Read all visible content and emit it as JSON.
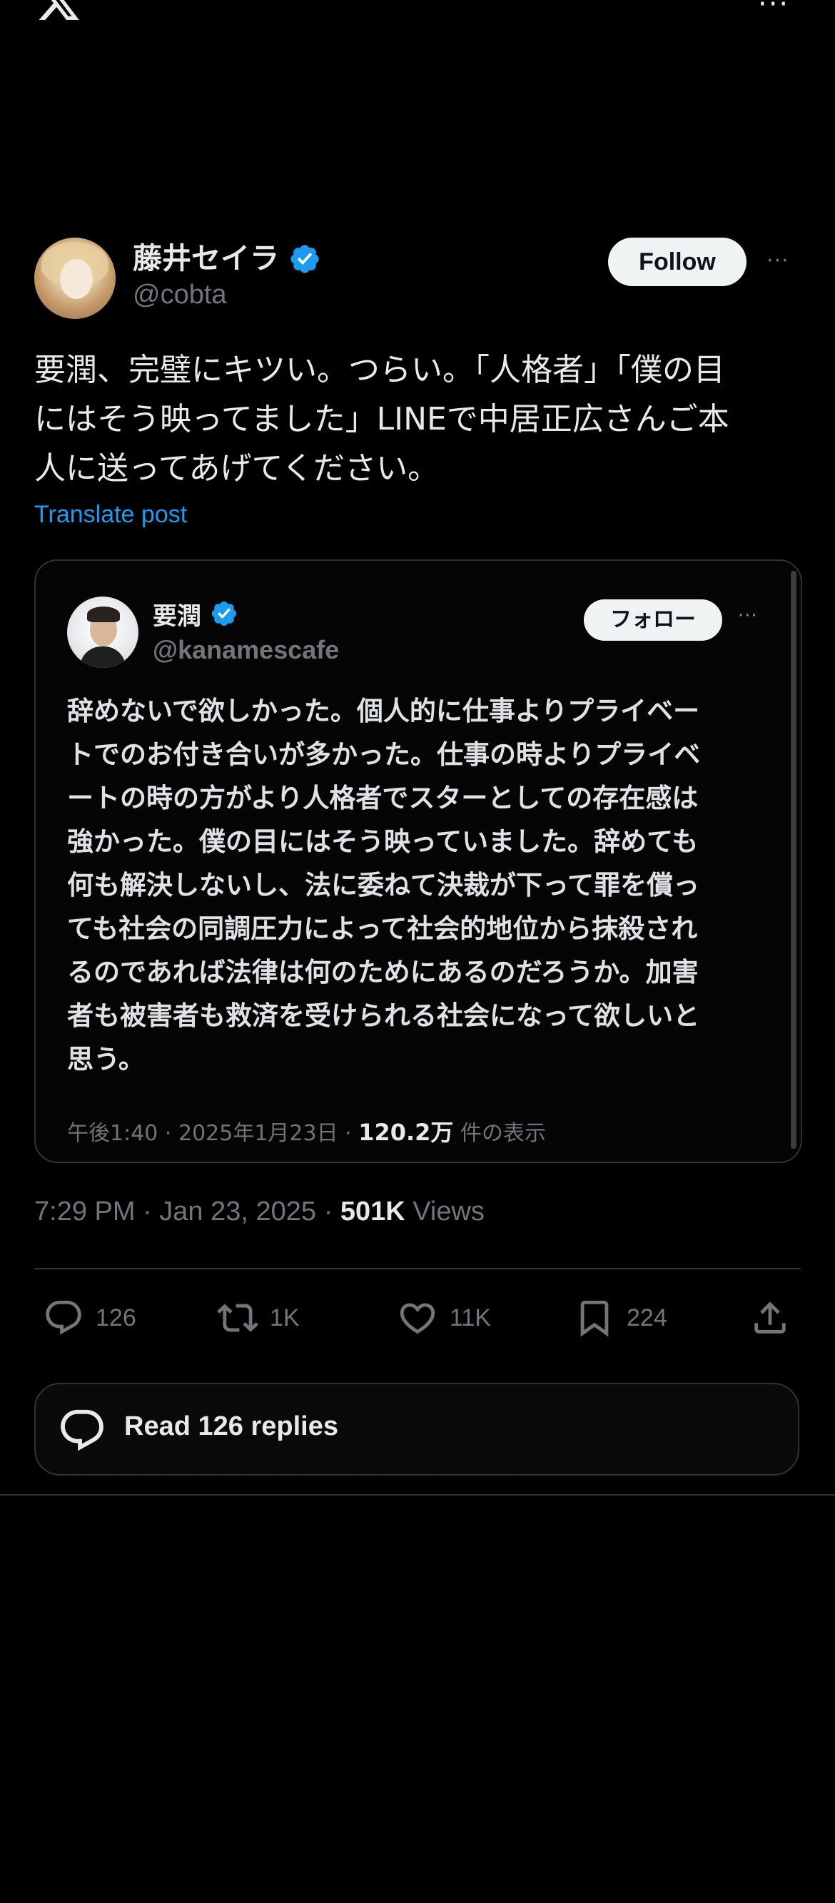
{
  "header": {
    "logo_icon": "x-logo-icon",
    "more_icon": "more-horizontal-icon",
    "more_text": "···"
  },
  "post": {
    "author_name": "藤井セイラ",
    "author_handle": "@cobta",
    "verified_icon": "verified-badge-icon",
    "follow_label": "Follow",
    "more_text": "···",
    "text": "要潤、完璧にキツい。つらい。「人格者」「僕の目\nにはそう映ってました」LINEで中居正広さんご本\n人に送ってあげてください。",
    "translate_label": "Translate post",
    "time": "7:29 PM · Jan 23, 2025 · ",
    "views_count": "501K",
    "views_label": " Views"
  },
  "quoted": {
    "author_name": "要潤",
    "author_handle": "@kanamescafe",
    "follow_label": "フォロー",
    "more_text": "···",
    "text": "辞めないで欲しかった。個人的に仕事よりプライベー\nトでのお付き合いが多かった。仕事の時よりプライベ\nートの時の方がより人格者でスターとしての存在感は\n強かった。僕の目にはそう映っていました。辞めても\n何も解決しないし、法に委ねて決裁が下って罪を償っ\nても社会の同調圧力によって社会的地位から抹殺され\nるのであれば法律は何のためにあるのだろうか。加害\n者も被害者も救済を受けられる社会になって欲しいと\n思う。",
    "meta_prefix": "午後1:40 · 2025年1月23日 · ",
    "views_count": "120.2万",
    "views_label": " 件の表示"
  },
  "actions": {
    "replies": "126",
    "reposts": "1K",
    "likes": "11K",
    "bookmarks": "224"
  },
  "read_replies": {
    "label": "Read 126 replies",
    "icon": "reply-bubble-icon"
  },
  "colors": {
    "background": "#000000",
    "text": "#e7e9ea",
    "muted": "#71767b",
    "accent": "#1d9bf0",
    "border": "#2f3336"
  }
}
